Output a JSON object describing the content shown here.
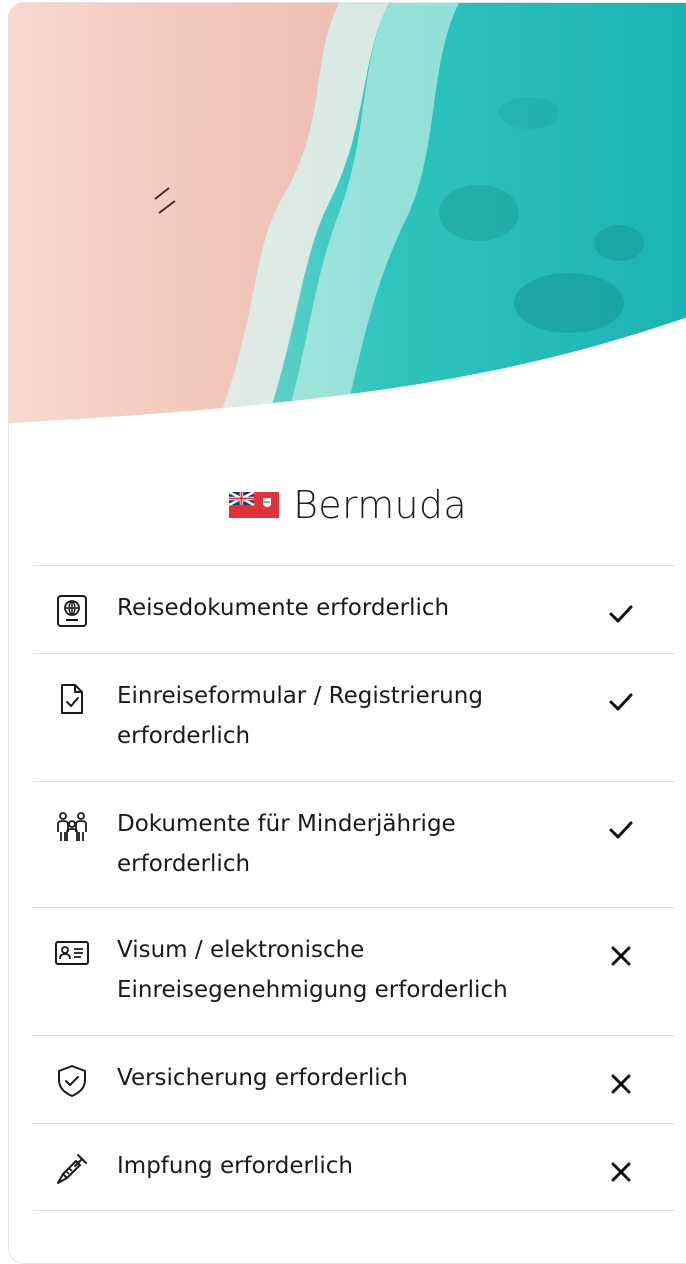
{
  "country": {
    "name": "Bermuda",
    "flag_icon": "bermuda-flag-icon"
  },
  "colors": {
    "text": "#1a1a1a",
    "divider": "#dcdcdc",
    "flag_red": "#e0323a"
  },
  "requirements": [
    {
      "label": "Reisedokumente erforderlich",
      "icon": "passport-icon",
      "status": "check-icon",
      "required": true
    },
    {
      "label": "Einreiseformular / Registrierung erforderlich",
      "icon": "document-check-icon",
      "status": "check-icon",
      "required": true
    },
    {
      "label": "Dokumente für Minderjährige erforderlich",
      "icon": "family-icon",
      "status": "check-icon",
      "required": true
    },
    {
      "label": "Visum / elektronische Einreisegenehmigung erforderlich",
      "icon": "id-card-icon",
      "status": "x-icon",
      "required": false
    },
    {
      "label": "Versicherung erforderlich",
      "icon": "shield-check-icon",
      "status": "x-icon",
      "required": false
    },
    {
      "label": "Impfung erforderlich",
      "icon": "syringe-icon",
      "status": "x-icon",
      "required": false
    }
  ]
}
